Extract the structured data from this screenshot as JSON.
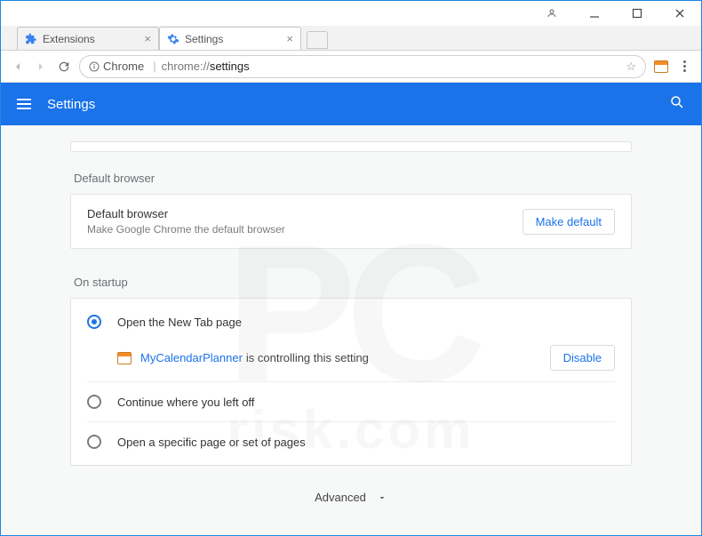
{
  "tabs": [
    {
      "label": "Extensions"
    },
    {
      "label": "Settings"
    }
  ],
  "address": {
    "scheme_label": "Chrome",
    "host": "chrome://",
    "path": "settings"
  },
  "header": {
    "title": "Settings"
  },
  "sections": {
    "default_browser": {
      "section_label": "Default browser",
      "row_title": "Default browser",
      "row_sub": "Make Google Chrome the default browser",
      "button": "Make default"
    },
    "on_startup": {
      "section_label": "On startup",
      "options": [
        "Open the New Tab page",
        "Continue where you left off",
        "Open a specific page or set of pages"
      ],
      "controlled": {
        "ext_name": "MyCalendarPlanner",
        "suffix": "is controlling this setting",
        "button": "Disable"
      }
    }
  },
  "advanced_label": "Advanced"
}
